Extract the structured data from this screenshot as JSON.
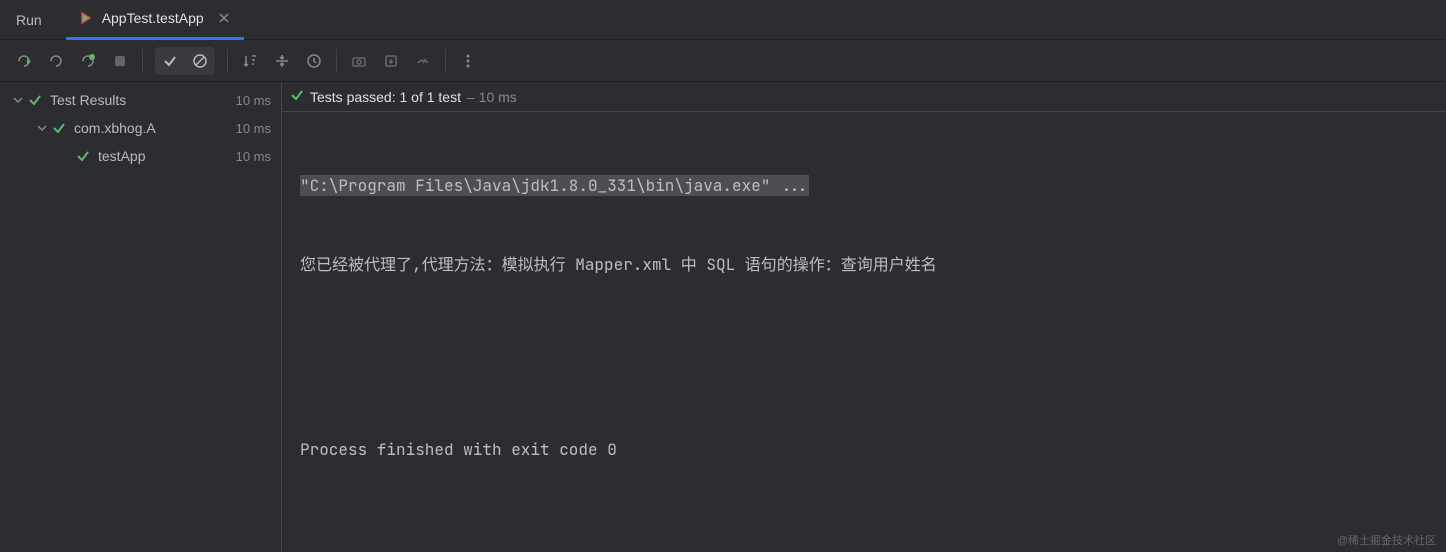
{
  "header": {
    "run_label": "Run",
    "tab_label": "AppTest.testApp"
  },
  "tree": {
    "rows": [
      {
        "label": "Test Results",
        "time": "10 ms",
        "indent": 0,
        "chevron": true
      },
      {
        "label": "com.xbhog.A",
        "time": "10 ms",
        "indent": 1,
        "chevron": true
      },
      {
        "label": "testApp",
        "time": "10 ms",
        "indent": 2,
        "chevron": false
      }
    ]
  },
  "status": {
    "text": "Tests passed: 1 of 1 test",
    "dim": "– 10 ms"
  },
  "console": {
    "line1": "\"C:\\Program Files\\Java\\jdk1.8.0_331\\bin\\java.exe\" ...",
    "line2": "您已经被代理了,代理方法：模拟执行 Mapper.xml 中 SQL 语句的操作：查询用户姓名",
    "line3": "",
    "line4": "",
    "line5": "Process finished with exit code 0"
  },
  "watermark": "@稀土掘金技术社区"
}
